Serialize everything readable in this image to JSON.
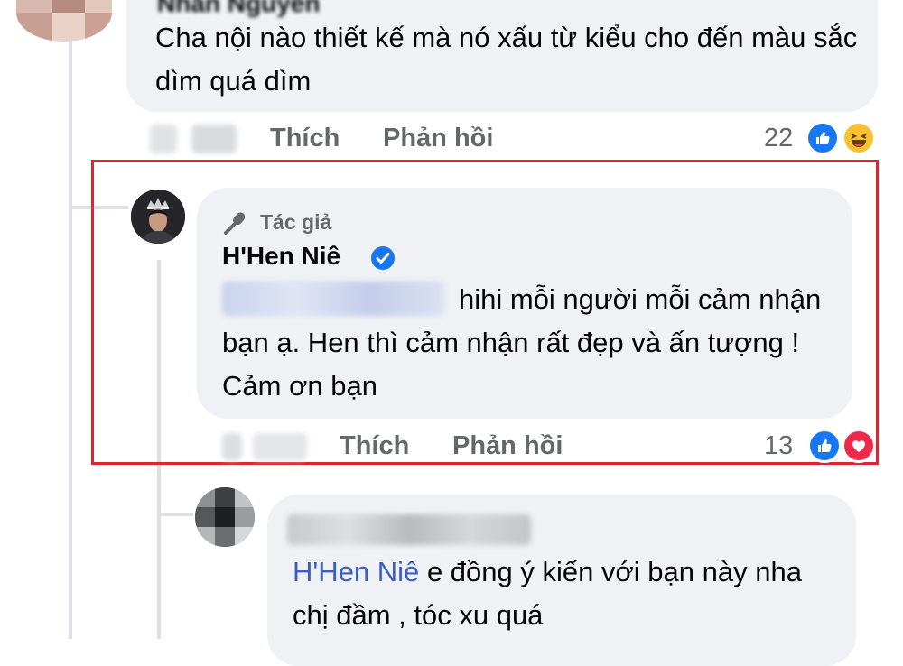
{
  "comment1": {
    "author_partial": "Nhàn Nguyễn",
    "text": "Cha nội nào thiết kế mà nó xấu từ kiểu cho đến màu sắc dìm quá dìm",
    "actions": {
      "like": "Thích",
      "reply": "Phản hồi"
    },
    "reaction_count": "22",
    "reactions": [
      "like-icon",
      "haha-icon"
    ]
  },
  "reply1": {
    "author_badge": "Tác giả",
    "author_name": "H'Hen Niê",
    "verified": true,
    "text": "hihi mỗi người mỗi cảm nhận bạn ạ. Hen thì cảm nhận rất đẹp và ấn tượng ! Cảm ơn bạn",
    "actions": {
      "like": "Thích",
      "reply": "Phản hồi"
    },
    "reaction_count": "13",
    "reactions": [
      "like-icon",
      "love-icon"
    ],
    "highlight_color": "#e0242d"
  },
  "reply2": {
    "mention": "H'Hen Niê",
    "text": "e đồng ý kiến với bạn này nha chị đầm , tóc xu quá"
  },
  "colors": {
    "bubble": "#eff1f4",
    "secondary_text": "#65676b",
    "mention": "#3b5ec4",
    "like_blue": "#1877f2",
    "verified_blue": "#1877f2"
  }
}
